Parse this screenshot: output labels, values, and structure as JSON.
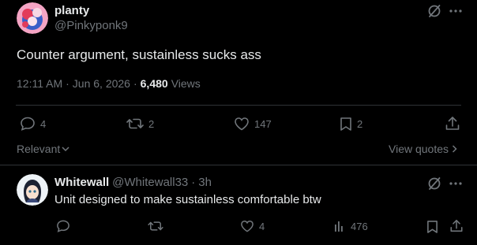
{
  "main_post": {
    "author_name": "planty",
    "author_handle": "@Pinkyponk9",
    "text": "Counter argument, sustainless sucks ass",
    "time": "12:11 AM",
    "date": "Jun 6, 2026",
    "sep1": "·",
    "sep2": "·",
    "views_count": "6,480",
    "views_label": "Views",
    "actions": {
      "replies": "4",
      "reposts": "2",
      "likes": "147",
      "bookmarks": "2"
    }
  },
  "sort": {
    "label": "Relevant",
    "view_quotes": "View quotes"
  },
  "reply": {
    "author_name": "Whitewall",
    "author_handle": "@Whitewall33",
    "sep": "·",
    "age": "3h",
    "text": "Unit designed to make sustainless comfortable btw",
    "actions": {
      "likes": "4",
      "views": "476"
    }
  },
  "icons": {
    "grok": "grok-icon",
    "more": "more-icon",
    "reply": "reply-icon",
    "repost": "repost-icon",
    "like": "heart-icon",
    "bookmark": "bookmark-icon",
    "share": "share-icon",
    "views": "views-icon",
    "chevron": "chevron-down-icon",
    "chevron_right": "chevron-right-icon"
  },
  "colors": {
    "background": "#000000",
    "text": "#e7e9ea",
    "muted": "#71767b",
    "divider": "#2f3336"
  }
}
